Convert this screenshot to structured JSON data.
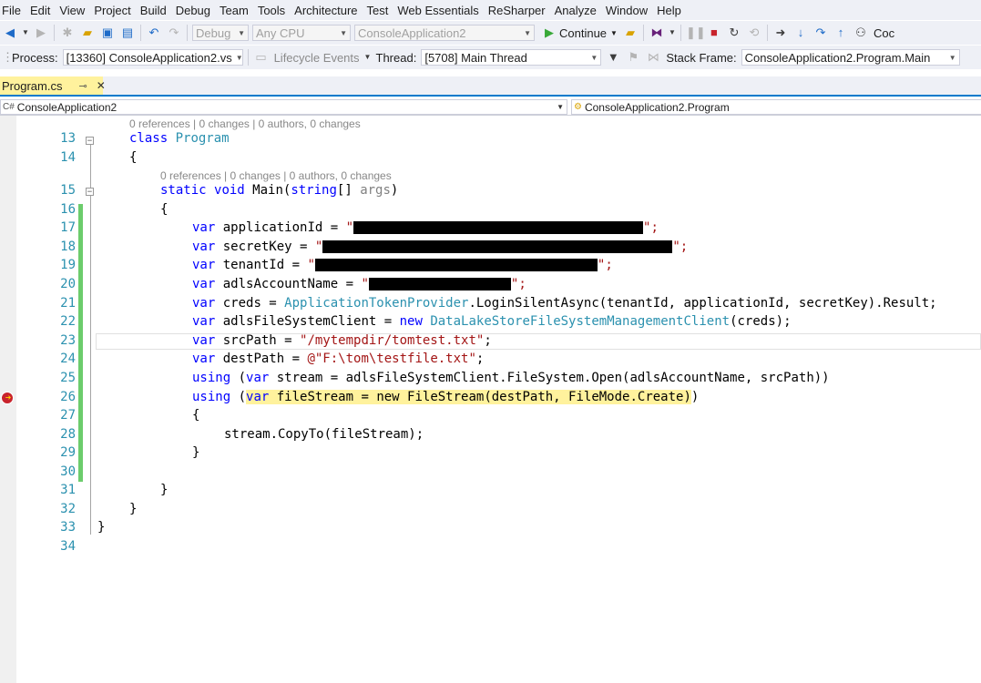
{
  "menu": [
    "File",
    "Edit",
    "View",
    "Project",
    "Build",
    "Debug",
    "Team",
    "Tools",
    "Architecture",
    "Test",
    "Web Essentials",
    "ReSharper",
    "Analyze",
    "Window",
    "Help"
  ],
  "toolbar1": {
    "config": "Debug",
    "platform": "Any CPU",
    "startup_project": "ConsoleApplication2",
    "continue_label": "Continue",
    "overflow_label": "Coc"
  },
  "toolbar2": {
    "process_label": "Process:",
    "process_value": "[13360] ConsoleApplication2.vs",
    "lifecycle_label": "Lifecycle Events",
    "thread_label": "Thread:",
    "thread_value": "[5708] Main Thread",
    "stackframe_label": "Stack Frame:",
    "stackframe_value": "ConsoleApplication2.Program.Main"
  },
  "tab": {
    "name": "Program.cs",
    "pin": "⊸",
    "close": "✕"
  },
  "navbar": {
    "project": "ConsoleApplication2",
    "type": "ConsoleApplication2.Program"
  },
  "lens": {
    "class_lens": "0 references | 0 changes | 0 authors, 0 changes",
    "method_lens": "0 references | 0 changes | 0 authors, 0 changes"
  },
  "code": {
    "l13": {
      "kw": "class",
      "name": "Program"
    },
    "l14": "{",
    "l15": {
      "kw1": "static",
      "kw2": "void",
      "name": "Main(",
      "kw3": "string",
      "rest": "[] ",
      "param": "args",
      "close": ")"
    },
    "l16": "{",
    "l17": {
      "kw": "var",
      "rest": " applicationId = ",
      "q1": "\"",
      "q2": "\";"
    },
    "l18": {
      "kw": "var",
      "rest": " secretKey = ",
      "q1": "\"",
      "q2": "\";"
    },
    "l19": {
      "kw": "var",
      "rest": " tenantId = ",
      "q1": "\"",
      "q2": "\";"
    },
    "l20": {
      "kw": "var",
      "rest": " adlsAccountName = ",
      "q1": "\"",
      "q2": "\";"
    },
    "l21": {
      "kw": "var",
      "rest1": " creds = ",
      "type": "ApplicationTokenProvider",
      "rest2": ".LoginSilentAsync(tenantId, applicationId, secretKey).Result;"
    },
    "l22": {
      "kw": "var",
      "rest1": " adlsFileSystemClient = ",
      "kw2": "new",
      "type": "DataLakeStoreFileSystemManagementClient",
      "rest2": "(creds);"
    },
    "l23": {
      "kw": "var",
      "rest": " srcPath = ",
      "str": "\"/mytempdir/tomtest.txt\"",
      "end": ";"
    },
    "l24": {
      "kw": "var",
      "rest": " destPath = ",
      "str": "@\"F:\\tom\\testfile.txt\"",
      "end": ";"
    },
    "l25": {
      "kw": "using",
      "p1": " (",
      "kw2": "var",
      "rest": " stream = adlsFileSystemClient.FileSystem.Open(adlsAccountName, srcPath))"
    },
    "l26": {
      "kw": "using",
      "p1": " (",
      "kw2": "var",
      "hl": " fileStream = new FileStream(destPath, FileMode.Create)",
      "close": ")"
    },
    "l27": "{",
    "l28": "stream.CopyTo(fileStream);",
    "l29": "}",
    "l31": "}",
    "l32": "}",
    "l33": "}"
  },
  "line_numbers": [
    "13",
    "14",
    "15",
    "16",
    "17",
    "18",
    "19",
    "20",
    "21",
    "22",
    "23",
    "24",
    "25",
    "26",
    "27",
    "28",
    "29",
    "30",
    "31",
    "32",
    "33",
    "34"
  ]
}
